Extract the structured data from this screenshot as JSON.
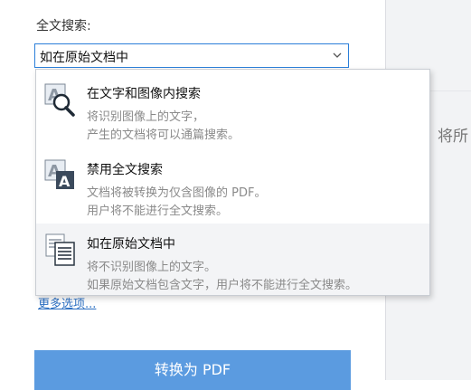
{
  "search": {
    "label": "全文搜索:",
    "selected": "如在原始文档中"
  },
  "options": [
    {
      "title": "在文字和图像内搜索",
      "desc1": "将识别图像上的文字，",
      "desc2": "产生的文档将可以通篇搜索。",
      "icon": "image-text-search-icon"
    },
    {
      "title": "禁用全文搜索",
      "desc1": "文档将被转换为仅含图像的 PDF。",
      "desc2": "用户将不能进行全文搜索。",
      "icon": "image-only-icon"
    },
    {
      "title": "如在原始文档中",
      "desc1": "将不识别图像上的文字。",
      "desc2": " 如果原始文档包含文字，用户将不能进行全文搜索。",
      "icon": "document-pages-icon"
    }
  ],
  "more_options": "更多选项...",
  "convert_button": "转换为 PDF",
  "right_panel": {
    "partial_text": "将所"
  },
  "colors": {
    "accent": "#2b7fd9",
    "button": "#5b9be0",
    "selected_row": "#f3f4f6",
    "panel": "#f2f3f5"
  }
}
